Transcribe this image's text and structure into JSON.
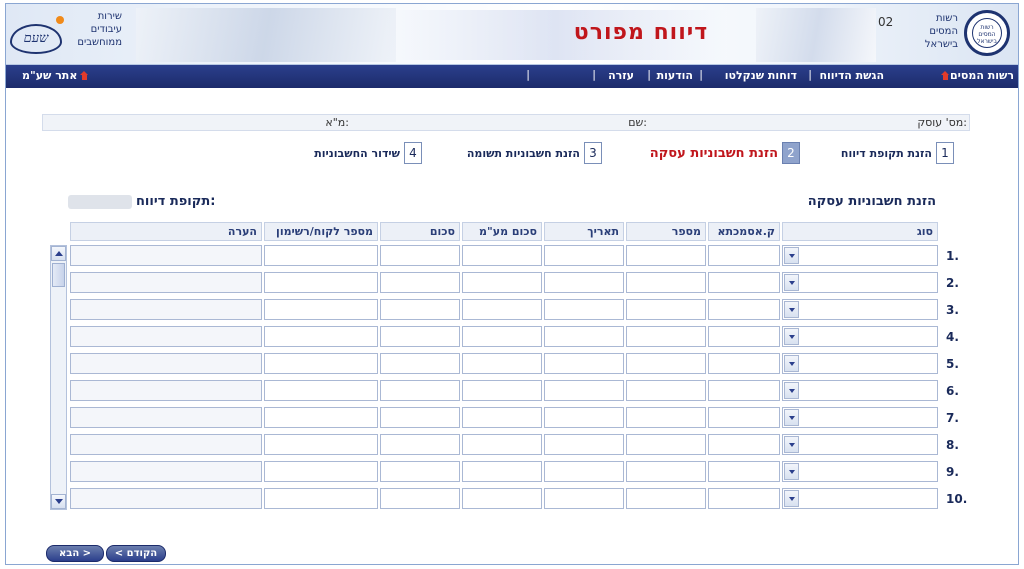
{
  "header": {
    "title": "דיווח מפורט",
    "user_id": "02",
    "tax_authority_text": [
      "רשות",
      "המסים",
      "בישראל"
    ],
    "tax_seal_text": "רשות המסים בישראל",
    "shaam_text": [
      "שירות",
      "עיבודים",
      "ממוחשבים"
    ],
    "shaam_mark": "שעם"
  },
  "nav": {
    "tax_authority": "רשות המסים",
    "report_submission": "הגשת הדיווח",
    "annual_reports": "דוחות שנקלטו",
    "messages": "הודעות",
    "help": "עזרה",
    "shaam_site": "אתר שע\"מ"
  },
  "info": {
    "business_no_label": "מס' עוסק:",
    "name_label": "שם:",
    "vat_label": "מ\"א:"
  },
  "steps": [
    {
      "num": "1",
      "label": "הזנת תקופת דיווח"
    },
    {
      "num": "2",
      "label": "הזנת חשבוניות עסקה"
    },
    {
      "num": "3",
      "label": "הזנת חשבוניות תשומה"
    },
    {
      "num": "4",
      "label": "שידור החשבוניות"
    }
  ],
  "section": {
    "title": "הזנת חשבוניות עסקה",
    "period_label": "תקופת דיווח:"
  },
  "table": {
    "columns": [
      "סוג",
      "ק.אסמכתא",
      "מספר",
      "תאריך",
      "סכום מע\"מ",
      "סכום",
      "מספר לקוח/רשימון",
      "הערה"
    ],
    "rows": [
      "1.",
      "2.",
      "3.",
      "4.",
      "5.",
      "6.",
      "7.",
      "8.",
      "9.",
      "10."
    ]
  },
  "buttons": {
    "previous": "< הקודם",
    "next": "הבא >"
  },
  "colors": {
    "title_red": "#c0161c",
    "nav_blue": "#1c2b6b",
    "text_navy": "#1a2a5a"
  }
}
